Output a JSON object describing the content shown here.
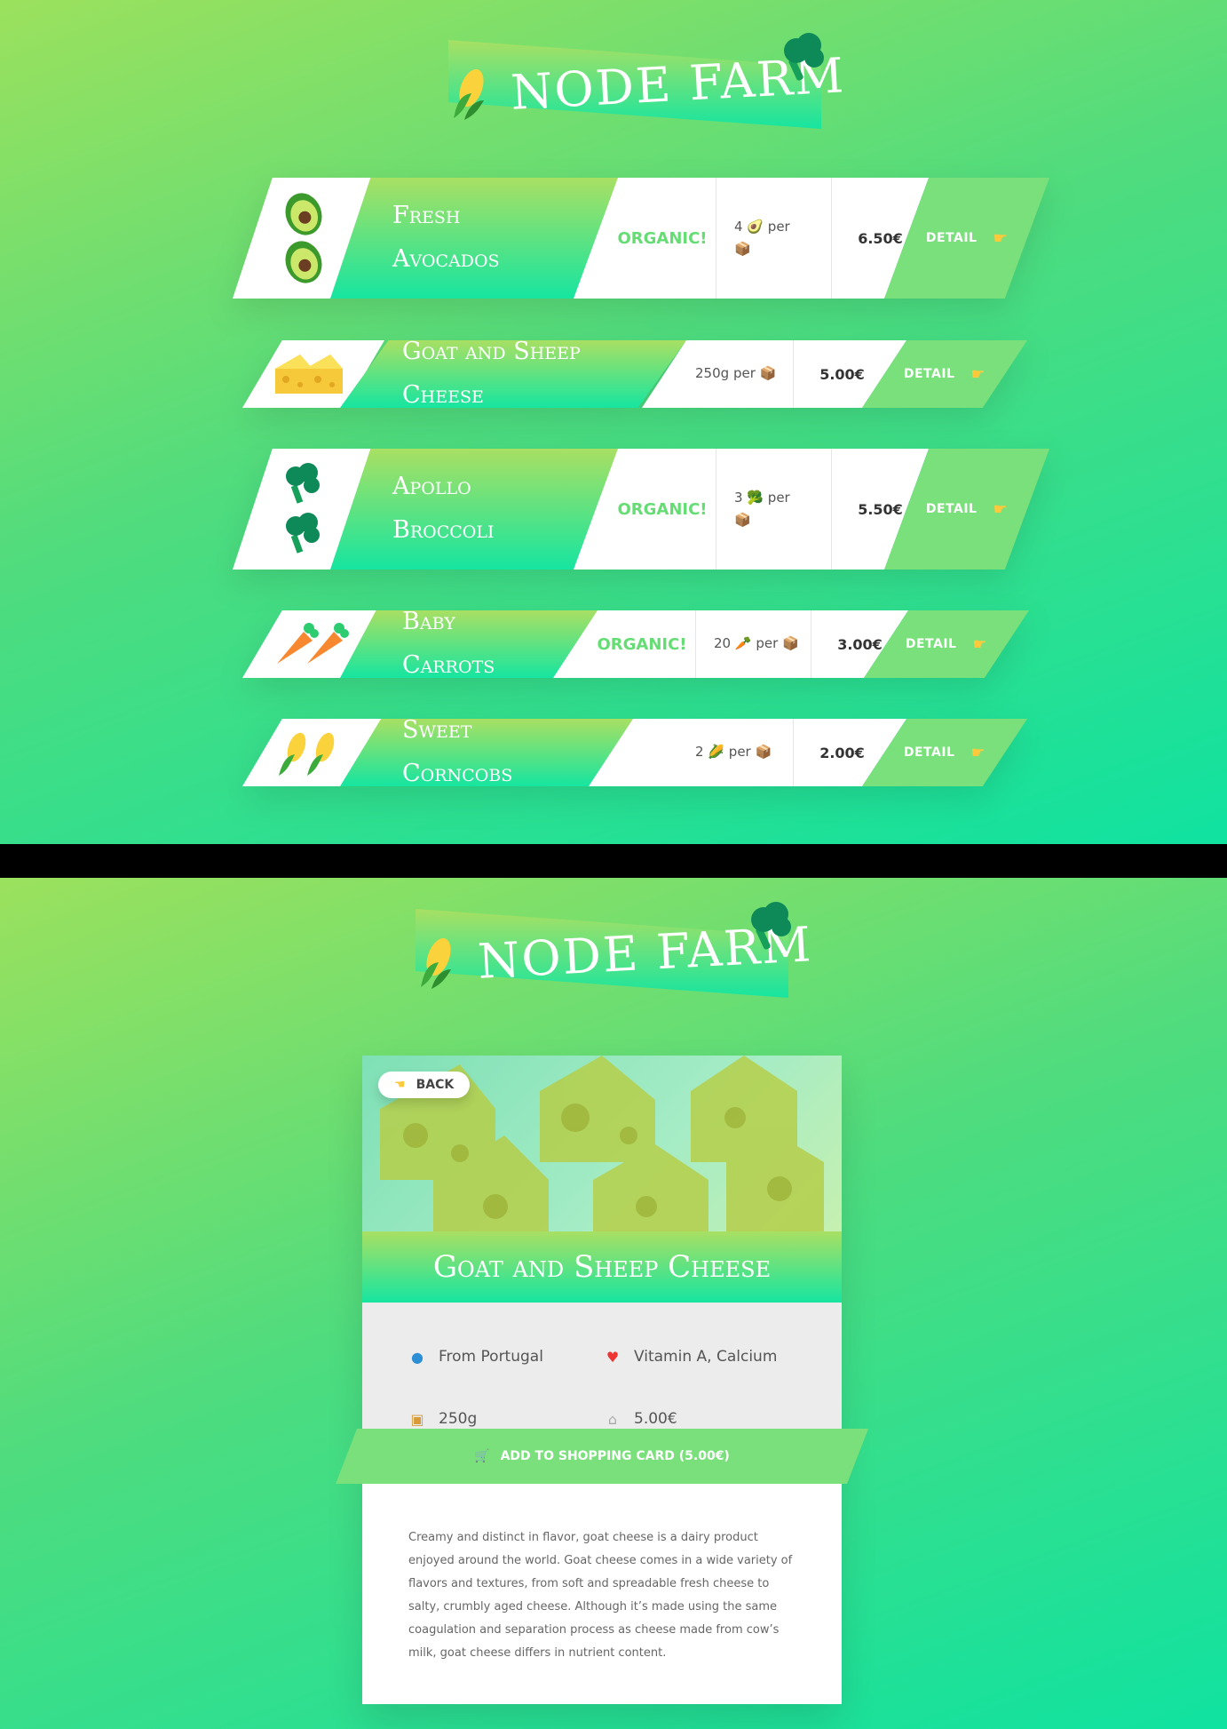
{
  "brand": {
    "title": "NODE FARM"
  },
  "products": [
    {
      "name": "Fresh Avocados",
      "organic": "ORGANIC!",
      "qty_prefix": "4",
      "qty_emoji": "🥑",
      "qty_suffix": "per",
      "box_emoji": "📦",
      "price": "6.50€",
      "detail": "DETAIL"
    },
    {
      "name": "Goat and Sheep Cheese",
      "organic": "",
      "qty_prefix": "250g",
      "qty_emoji": "",
      "qty_suffix": "per",
      "box_emoji": "📦",
      "price": "5.00€",
      "detail": "DETAIL"
    },
    {
      "name": "Apollo Broccoli",
      "organic": "ORGANIC!",
      "qty_prefix": "3",
      "qty_emoji": "🥦",
      "qty_suffix": "per",
      "box_emoji": "📦",
      "price": "5.50€",
      "detail": "DETAIL"
    },
    {
      "name": "Baby Carrots",
      "organic": "ORGANIC!",
      "qty_prefix": "20",
      "qty_emoji": "🥕",
      "qty_suffix": "per",
      "box_emoji": "📦",
      "price": "3.00€",
      "detail": "DETAIL"
    },
    {
      "name": "Sweet Corncobs",
      "organic": "",
      "qty_prefix": "2",
      "qty_emoji": "🌽",
      "qty_suffix": "per",
      "box_emoji": "📦",
      "price": "2.00€",
      "detail": "DETAIL"
    }
  ],
  "detail": {
    "back": "BACK",
    "title": "Goat and Sheep Cheese",
    "from": "From Portugal",
    "nutrients": "Vitamin A, Calcium",
    "quantity": "250g",
    "price": "5.00€",
    "cart": "ADD TO SHOPPING CARD (5.00€)",
    "description": "Creamy and distinct in flavor, goat cheese is a dairy product enjoyed around the world. Goat cheese comes in a wide variety of flavors and textures, from soft and spreadable fresh cheese to salty, crumbly aged cheese. Although it’s made using the same coagulation and separation process as cheese made from cow’s milk, goat cheese differs in nutrient content."
  },
  "icons": [
    "corn-icon",
    "broccoli-icon",
    "avocado-icon",
    "cheese-icon",
    "carrot-icon",
    "pointing-hand-icon",
    "globe-icon",
    "heart-icon",
    "box-icon",
    "price-tag-icon",
    "cart-icon"
  ],
  "colors": {
    "accent": "#79e07b",
    "organic": "#66dd74",
    "gradient_top": "#a8e063",
    "gradient_bottom": "#16e5a0"
  }
}
